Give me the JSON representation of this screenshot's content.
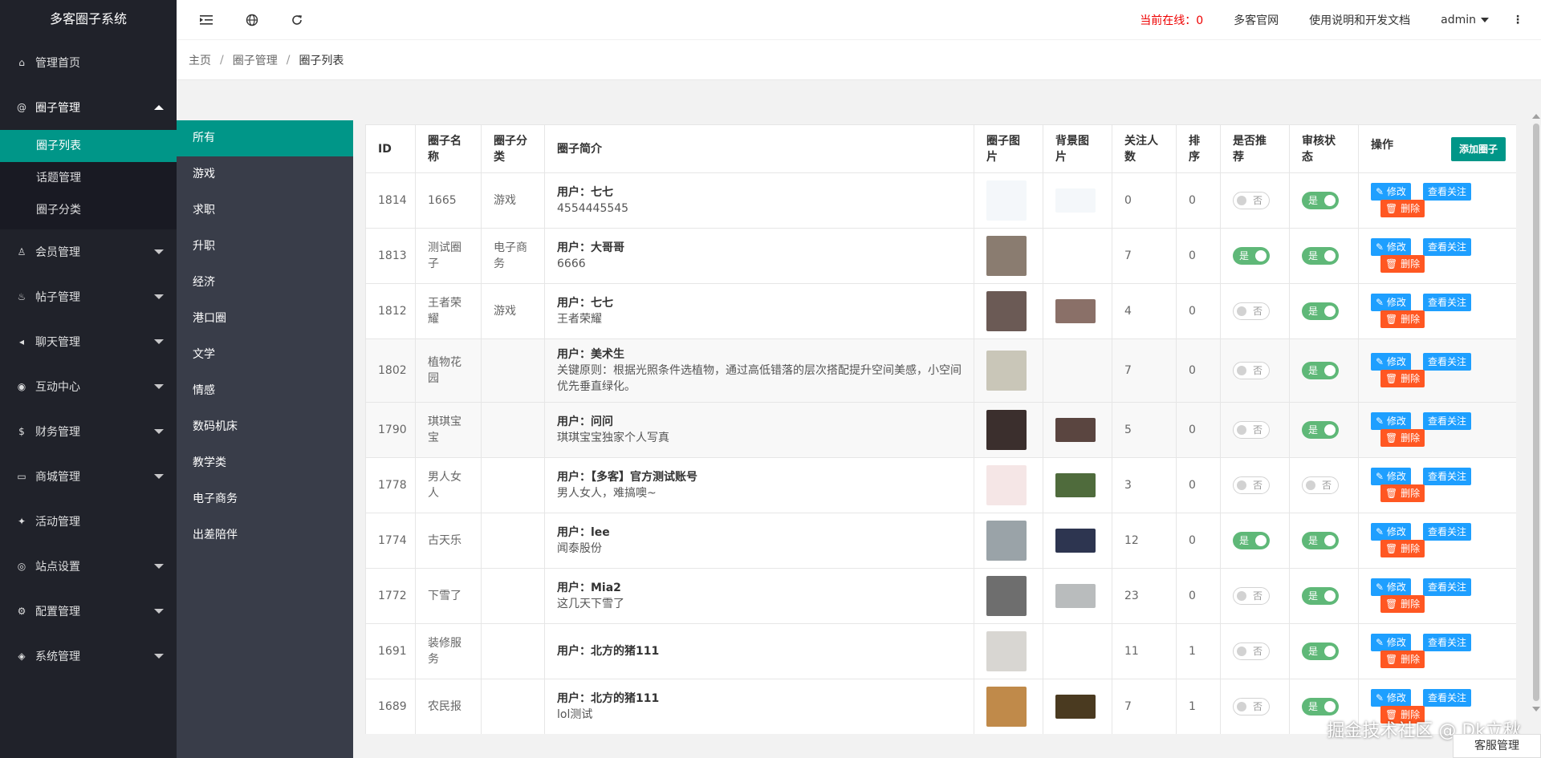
{
  "app": {
    "title": "多客圈子系统"
  },
  "sidebar": {
    "items": [
      {
        "label": "管理首页",
        "icon": "home-icon"
      },
      {
        "label": "圈子管理",
        "icon": "at-icon",
        "open": true,
        "children": [
          {
            "label": "圈子列表",
            "active": true
          },
          {
            "label": "话题管理"
          },
          {
            "label": "圈子分类"
          }
        ]
      },
      {
        "label": "会员管理",
        "icon": "user-icon"
      },
      {
        "label": "帖子管理",
        "icon": "fire-icon"
      },
      {
        "label": "聊天管理",
        "icon": "speaker-icon"
      },
      {
        "label": "互动中心",
        "icon": "compass-icon"
      },
      {
        "label": "财务管理",
        "icon": "dollar-icon"
      },
      {
        "label": "商城管理",
        "icon": "cart-icon"
      },
      {
        "label": "活动管理",
        "icon": "activity-icon"
      },
      {
        "label": "站点设置",
        "icon": "site-icon"
      },
      {
        "label": "配置管理",
        "icon": "gear-icon"
      },
      {
        "label": "系统管理",
        "icon": "cube-icon"
      }
    ]
  },
  "header": {
    "online_label": "当前在线：",
    "online_count": "0",
    "link_official": "多客官网",
    "link_docs": "使用说明和开发文档",
    "user": "admin"
  },
  "breadcrumb": [
    "主页",
    "圈子管理",
    "圈子列表"
  ],
  "categories": [
    "所有",
    "游戏",
    "求职",
    "升职",
    "经济",
    "港口圈",
    "文学",
    "情感",
    "数码机床",
    "教学类",
    "电子商务",
    "出差陪伴"
  ],
  "table": {
    "headers": {
      "id": "ID",
      "name": "圈子名称",
      "category": "圈子分类",
      "intro": "圈子简介",
      "image": "圈子图片",
      "bg": "背景图片",
      "followers": "关注人数",
      "sort": "排序",
      "recommend": "是否推荐",
      "review": "审核状态",
      "ops": "操作"
    },
    "add_button": "添加圈子",
    "edit_label": "修改",
    "follow_label": "查看关注",
    "delete_label": "删除",
    "yes": "是",
    "no": "否",
    "rows": [
      {
        "id": "1814",
        "name": "1665",
        "category": "游戏",
        "user": "用户：七七",
        "intro": "4554445545",
        "img_color": "#f4f7fa",
        "bg_color": "#f4f7fa",
        "followers": "0",
        "sort": "0",
        "recommend": false,
        "review": true
      },
      {
        "id": "1813",
        "name": "测试圈子",
        "category": "电子商务",
        "user": "用户：大哥哥",
        "intro": "6666",
        "img_color": "#8a7c70",
        "bg_color": "",
        "followers": "7",
        "sort": "0",
        "recommend": true,
        "review": true
      },
      {
        "id": "1812",
        "name": "王者荣耀",
        "category": "游戏",
        "user": "用户：七七",
        "intro": "王者荣耀",
        "img_color": "#6b5a55",
        "bg_color": "#8a7068",
        "followers": "4",
        "sort": "0",
        "recommend": false,
        "review": true
      },
      {
        "id": "1802",
        "name": "植物花园",
        "category": "",
        "user": "用户：美术生",
        "intro": "关键原则：根据光照条件选植物，通过高低错落的层次搭配提升空间美感，小空间优先垂直绿化。",
        "img_color": "#c9c6b8",
        "bg_color": "",
        "followers": "7",
        "sort": "0",
        "recommend": false,
        "review": true
      },
      {
        "id": "1790",
        "name": "琪琪宝宝",
        "category": "",
        "user": "用户：问问",
        "intro": "琪琪宝宝独家个人写真",
        "img_color": "#3b2f2d",
        "bg_color": "#5a4540",
        "followers": "5",
        "sort": "0",
        "recommend": false,
        "review": true
      },
      {
        "id": "1778",
        "name": "男人女人",
        "category": "",
        "user": "用户：【多客】官方测试账号",
        "intro": "男人女人，难搞噢~",
        "img_color": "#f5e6e6",
        "bg_color": "#4f6b3c",
        "followers": "3",
        "sort": "0",
        "recommend": false,
        "review": false
      },
      {
        "id": "1774",
        "name": "古天乐",
        "category": "",
        "user": "用户：lee",
        "intro": "闻泰股份",
        "img_color": "#9aa3a8",
        "bg_color": "#2d3550",
        "followers": "12",
        "sort": "0",
        "recommend": true,
        "review": true
      },
      {
        "id": "1772",
        "name": "下雪了",
        "category": "",
        "user": "用户：Mia2",
        "intro": "这几天下雪了",
        "img_color": "#6e6e6e",
        "bg_color": "#b9bcbd",
        "followers": "23",
        "sort": "0",
        "recommend": false,
        "review": true
      },
      {
        "id": "1691",
        "name": "装修服务",
        "category": "",
        "user": "用户：北方的猪111",
        "intro": "",
        "img_color": "#d8d6d2",
        "bg_color": "",
        "followers": "11",
        "sort": "1",
        "recommend": false,
        "review": true
      },
      {
        "id": "1689",
        "name": "农民报",
        "category": "",
        "user": "用户：北方的猪111",
        "intro": "lol测试",
        "img_color": "#c08a4a",
        "bg_color": "#4a3a20",
        "followers": "7",
        "sort": "1",
        "recommend": false,
        "review": true
      }
    ]
  },
  "watermark": "掘金技术社区 @ Dk立秋",
  "service_label": "客服管理"
}
